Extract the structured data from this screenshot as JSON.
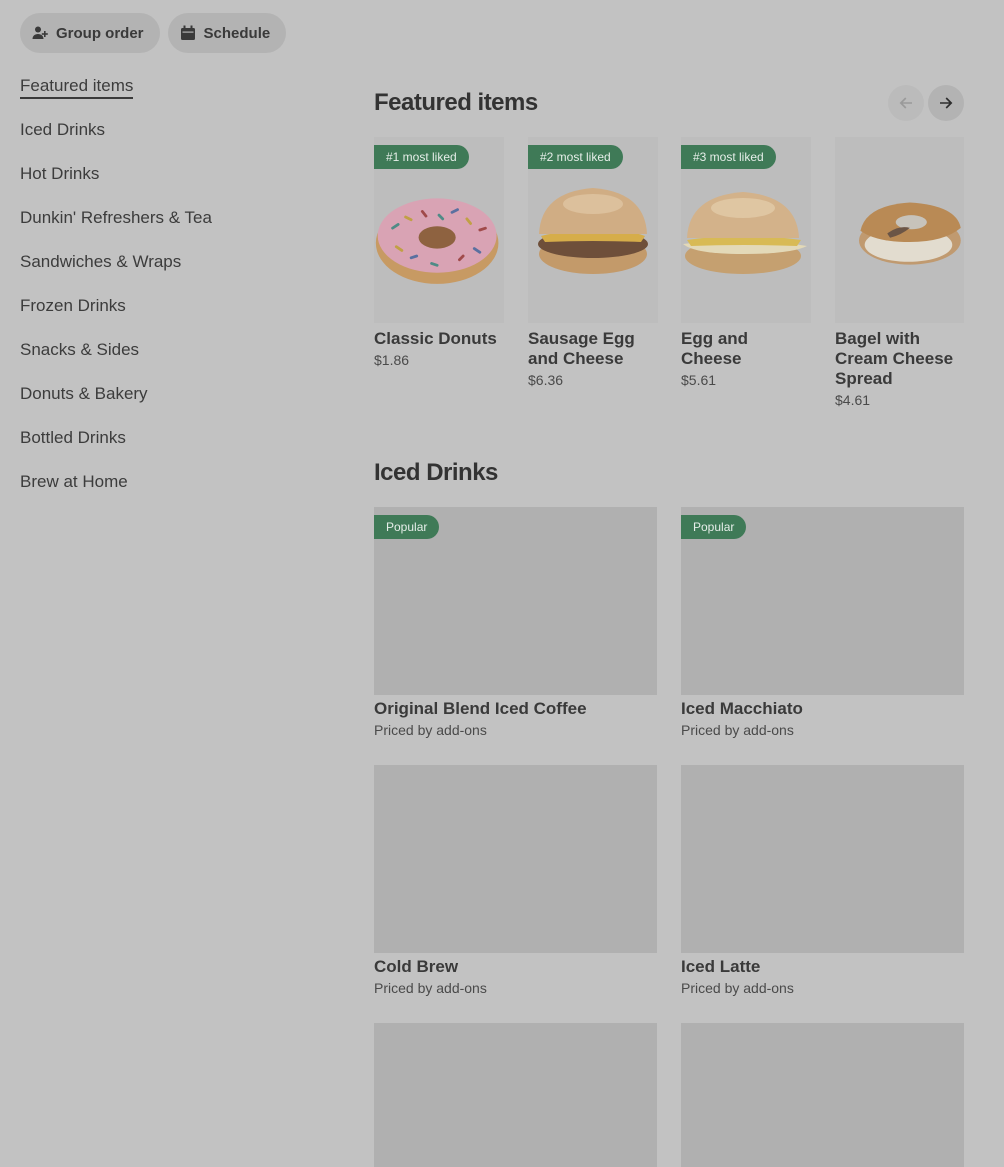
{
  "top_buttons": {
    "group_order": "Group order",
    "schedule": "Schedule"
  },
  "sidebar": {
    "items": [
      {
        "label": "Featured items",
        "active": true
      },
      {
        "label": "Iced Drinks"
      },
      {
        "label": "Hot Drinks"
      },
      {
        "label": "Dunkin' Refreshers & Tea"
      },
      {
        "label": "Sandwiches & Wraps"
      },
      {
        "label": "Frozen Drinks"
      },
      {
        "label": "Snacks & Sides"
      },
      {
        "label": "Donuts & Bakery"
      },
      {
        "label": "Bottled Drinks"
      },
      {
        "label": "Brew at Home"
      }
    ]
  },
  "featured": {
    "title": "Featured items",
    "items": [
      {
        "badge": "#1 most liked",
        "name": "Classic Donuts",
        "price": "$1.86",
        "icon": "donut-image"
      },
      {
        "badge": "#2 most liked",
        "name": "Sausage Egg and Cheese",
        "price": "$6.36",
        "icon": "sausage-sandwich-image"
      },
      {
        "badge": "#3 most liked",
        "name": "Egg and Cheese",
        "price": "$5.61",
        "icon": "egg-sandwich-image"
      },
      {
        "badge": "",
        "name": "Bagel with Cream Cheese Spread",
        "price": "$4.61",
        "icon": "bagel-image"
      }
    ]
  },
  "iced": {
    "title": "Iced Drinks",
    "items": [
      {
        "badge": "Popular",
        "name": "Original Blend Iced Coffee",
        "price": "Priced by add-ons"
      },
      {
        "badge": "Popular",
        "name": "Iced Macchiato",
        "price": "Priced by add-ons"
      },
      {
        "badge": "",
        "name": "Cold Brew",
        "price": "Priced by add-ons"
      },
      {
        "badge": "",
        "name": "Iced Latte",
        "price": "Priced by add-ons"
      },
      {
        "badge": "",
        "name": "",
        "price": ""
      },
      {
        "badge": "",
        "name": "",
        "price": ""
      }
    ]
  },
  "colors": {
    "badge_green": "#3f7a57",
    "overlay_bg": "#c2c2c2"
  }
}
